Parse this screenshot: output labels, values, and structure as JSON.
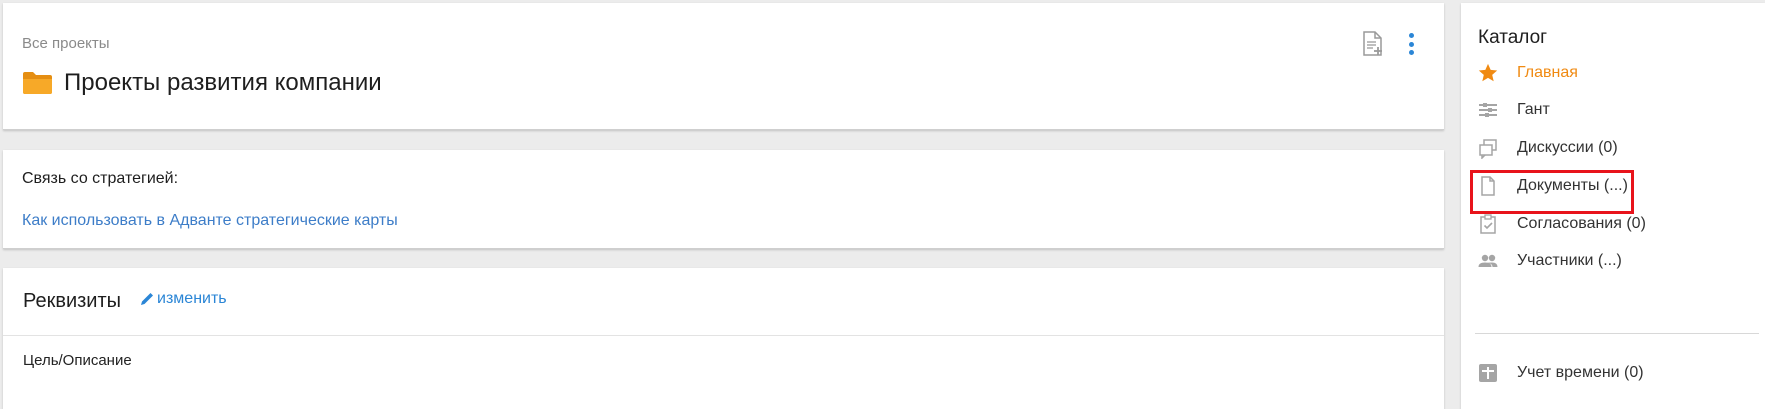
{
  "header": {
    "breadcrumb": "Все проекты",
    "title": "Проекты развития компании",
    "icons": {
      "folder": "folder-icon",
      "add_document": "document-add-icon",
      "more": "kebab-menu-icon"
    }
  },
  "strategy": {
    "label": "Связь со стратегией:",
    "link_text": "Как использовать в Адванте стратегические карты"
  },
  "requisites": {
    "title": "Реквизиты",
    "edit_label": "изменить",
    "field_label": "Цель/Описание"
  },
  "catalog": {
    "title": "Каталог",
    "items": [
      {
        "label": "Главная",
        "icon": "star-icon",
        "active": true
      },
      {
        "label": "Гант",
        "icon": "gantt-icon"
      },
      {
        "label": "Дискуссии (0)",
        "icon": "discussions-icon"
      },
      {
        "label": "Документы (...)",
        "icon": "document-icon",
        "highlighted": true
      },
      {
        "label": "Согласования (0)",
        "icon": "approval-icon"
      },
      {
        "label": "Участники (...)",
        "icon": "participants-icon"
      },
      {
        "label": "Учет времени (0)",
        "icon": "time-tracking-icon"
      }
    ]
  },
  "colors": {
    "accent_blue": "#2b86d6",
    "link_blue": "#3d7dc8",
    "active_orange": "#f08a12",
    "highlight_red": "#e8131b",
    "folder_orange": "#f5a623"
  }
}
